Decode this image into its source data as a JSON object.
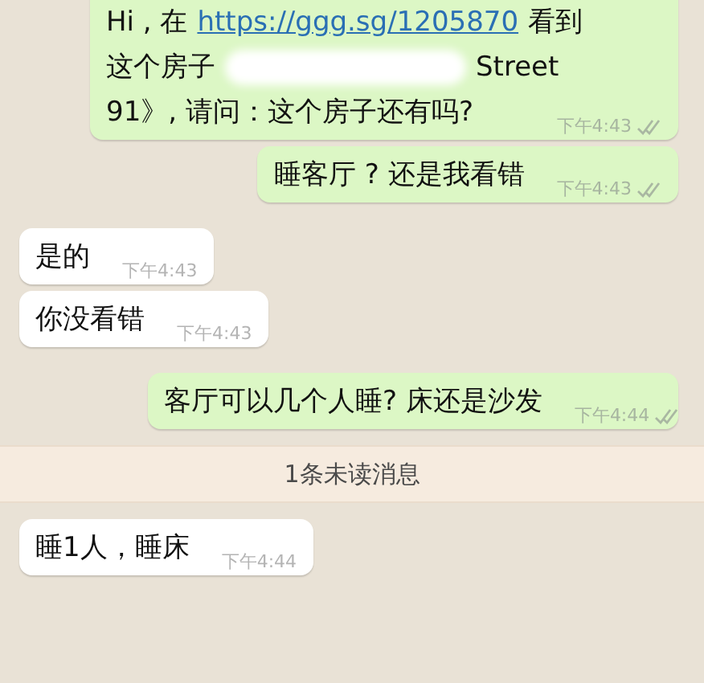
{
  "messages": [
    {
      "outgoing": true,
      "lines": [
        [
          {
            "kind": "text",
            "text": "Hi , 在"
          },
          {
            "kind": "link",
            "text": "https://ggg.sg/1205870"
          },
          {
            "kind": "text",
            "text": "看到"
          }
        ],
        [
          {
            "kind": "text",
            "text": "这个房子"
          },
          {
            "kind": "redacted"
          },
          {
            "kind": "text",
            "text": "Street"
          }
        ],
        [
          {
            "kind": "text",
            "text": "91》, 请问：这个房子还有吗?"
          }
        ]
      ],
      "time": "下午4:43",
      "read": false
    },
    {
      "outgoing": true,
      "lines": [
        [
          {
            "kind": "text",
            "text": "睡客厅 ? 还是我看错"
          }
        ]
      ],
      "time": "下午4:43",
      "read": false
    },
    {
      "outgoing": false,
      "lines": [
        [
          {
            "kind": "text",
            "text": "是的"
          }
        ]
      ],
      "time": "下午4:43"
    },
    {
      "outgoing": false,
      "lines": [
        [
          {
            "kind": "text",
            "text": "你没看错"
          }
        ]
      ],
      "time": "下午4:43"
    },
    {
      "outgoing": true,
      "lines": [
        [
          {
            "kind": "text",
            "text": "客厅可以几个人睡? 床还是沙发"
          }
        ]
      ],
      "time": "下午4:44",
      "read": false
    }
  ],
  "unread_banner": "1条未读消息",
  "after_banner": [
    {
      "outgoing": false,
      "lines": [
        [
          {
            "kind": "text",
            "text": "睡1人，睡床"
          }
        ]
      ],
      "time": "下午4:44"
    }
  ]
}
